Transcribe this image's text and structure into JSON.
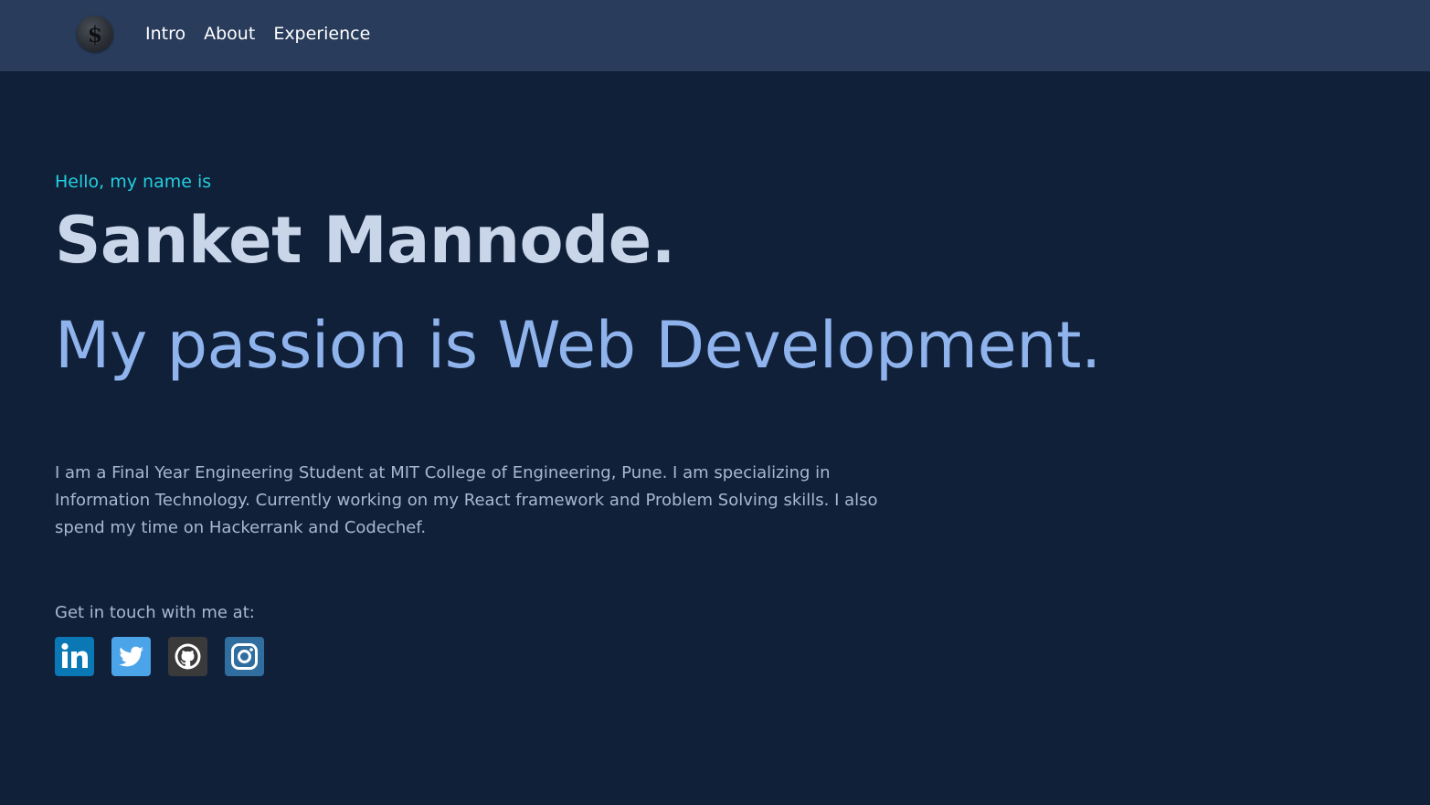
{
  "nav": {
    "logo_glyph": "$",
    "links": [
      {
        "label": "Intro"
      },
      {
        "label": "About"
      },
      {
        "label": "Experience"
      }
    ]
  },
  "hero": {
    "greeting": "Hello, my name is",
    "name": "Sanket Mannode.",
    "tagline": "My passion is Web Development.",
    "bio": "I am a Final Year Engineering Student at MIT College of Engineering, Pune. I am specializing in Information Technology. Currently working on my React framework and Problem Solving skills. I also spend my time on Hackerrank and Codechef.",
    "contact_label": "Get in touch with me at:"
  },
  "socials": [
    {
      "icon": "linkedin-icon",
      "color": "#0a78b5"
    },
    {
      "icon": "twitter-icon",
      "color": "#4ba3e8"
    },
    {
      "icon": "github-icon",
      "color": "#3a3a3a"
    },
    {
      "icon": "instagram-icon",
      "color": "#2f6e9e"
    }
  ],
  "colors": {
    "background": "#112039",
    "navbar": "#293c5c",
    "greeting": "#22cfe0",
    "name": "#c9d6ea",
    "tagline": "#8fb3ec",
    "body_text": "#a9b8cf"
  }
}
